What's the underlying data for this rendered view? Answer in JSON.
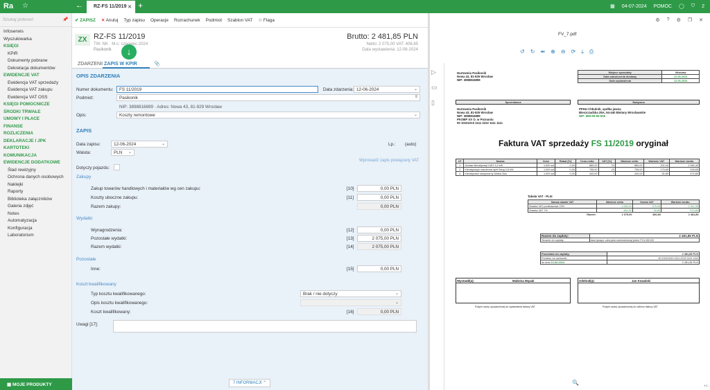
{
  "app": {
    "logo": "Ra",
    "tab_title": "RZ-FS 11/2019",
    "date": "04-07-2024",
    "help": "POMOC",
    "badge": "2"
  },
  "sidebar": {
    "search_placeholder": "Szukaj poleceń",
    "items": [
      {
        "label": "Infoserwis",
        "type": "item"
      },
      {
        "label": "Wyszukiwarka",
        "type": "item"
      },
      {
        "label": "KSIĘGI",
        "type": "head"
      },
      {
        "label": "KPiR",
        "type": "sub"
      },
      {
        "label": "Dokumenty pobrane",
        "type": "sub"
      },
      {
        "label": "Dekretacja dokumentów",
        "type": "sub"
      },
      {
        "label": "EWIDENCJE VAT",
        "type": "head"
      },
      {
        "label": "Ewidencja VAT sprzedaży",
        "type": "sub"
      },
      {
        "label": "Ewidencja VAT zakupu",
        "type": "sub"
      },
      {
        "label": "Ewidencja VAT OSS",
        "type": "sub"
      },
      {
        "label": "KSIĘGI POMOCNICZE",
        "type": "head"
      },
      {
        "label": "ŚRODKI TRWAŁE",
        "type": "head"
      },
      {
        "label": "UMOWY I PŁACE",
        "type": "head"
      },
      {
        "label": "FINANSE",
        "type": "head"
      },
      {
        "label": "ROZLICZENIA",
        "type": "head"
      },
      {
        "label": "DEKLARACJE I JPK",
        "type": "head"
      },
      {
        "label": "KARTOTEKI",
        "type": "head"
      },
      {
        "label": "KOMUNIKACJA",
        "type": "head"
      },
      {
        "label": "EWIDENCJE DODATKOWE",
        "type": "head"
      },
      {
        "label": "Ślad rewizyjny",
        "type": "sub"
      },
      {
        "label": "Ochrona danych osobowych",
        "type": "sub"
      },
      {
        "label": "Naklejki",
        "type": "sub"
      },
      {
        "label": "Raporty",
        "type": "sub"
      },
      {
        "label": "Biblioteka załączników",
        "type": "sub"
      },
      {
        "label": "Galeria zdjęć",
        "type": "sub"
      },
      {
        "label": "Notes",
        "type": "sub"
      },
      {
        "label": "Automatyzacja",
        "type": "sub"
      },
      {
        "label": "Konfiguracja",
        "type": "sub"
      },
      {
        "label": "Laboratorium",
        "type": "sub"
      }
    ],
    "my_products": "MOJE PRODUKTY"
  },
  "toolbar": {
    "save": "ZAPISZ",
    "cancel": "Anuluj",
    "type": "Typ zapisu",
    "ops": "Operacje",
    "settle": "Rozrachunek",
    "subject": "Podmiot",
    "template": "Szablon VAT",
    "flag": "Flaga"
  },
  "header": {
    "badge": "ZX",
    "title": "RZ-FS 11/2019",
    "sub": "TW: NK · M-c: czerwiec-2024",
    "sub2": "Pasikonik",
    "brutto": "Brutto: 2 481,85 PLN",
    "netto": "Netto: 2 075,00 VAT: 406,85",
    "issued": "Data wystawienia: 12-06-2024"
  },
  "tabs": {
    "event": "ZDARZENIE",
    "kpir": "ZAPIS W KPIR"
  },
  "event": {
    "section": "OPIS ZDARZENIA",
    "docnum_label": "Numer dokumentu:",
    "docnum": "FS 11/2019",
    "date_label": "Data zdarzenia:",
    "date": "12-06-2024",
    "subject_label": "Podmiot:",
    "subject": "Pasikonik",
    "nip": "NIP: 3898816899  ·  Adres: Nowa 43, 81-929 Wrocław",
    "desc_label": "Opis:",
    "desc": "Koszty remontowe"
  },
  "entry": {
    "section": "ZAPIS",
    "date_label": "Data zapisu:",
    "date": "12-06-2024",
    "lp_label": "Lp.:",
    "lp": "(auto)",
    "currency_label": "Waluta:",
    "currency": "PLN",
    "link": "Wprowadź zapis powiązany VAT",
    "vehicle": "Dotyczy pojazdu:"
  },
  "purchases": {
    "title": "Zakupy",
    "rows": [
      {
        "label": "Zakup towarów handlowych i materiałów wg cen zakupu:",
        "col": "[10]",
        "value": "0,00 PLN"
      },
      {
        "label": "Koszty uboczne zakupu:",
        "col": "[11]",
        "value": "0,00 PLN"
      },
      {
        "label": "Razem zakupy:",
        "col": "",
        "value": "0,00 PLN"
      }
    ]
  },
  "expenses": {
    "title": "Wydatki",
    "rows": [
      {
        "label": "Wynagrodzenia:",
        "col": "[12]",
        "value": "0,00 PLN"
      },
      {
        "label": "Pozostałe wydatki:",
        "col": "[13]",
        "value": "2 075,00 PLN"
      },
      {
        "label": "Razem wydatki:",
        "col": "[14]",
        "value": "2 075,00 PLN"
      }
    ]
  },
  "other": {
    "title": "Pozostałe",
    "label": "Inne:",
    "col": "[15]",
    "value": "0,00 PLN"
  },
  "qualified": {
    "title": "Koszt kwalifikowany",
    "type_label": "Typ kosztu kwalifikowanego:",
    "type": "Brak / nie dotyczy",
    "desc_label": "Opis kosztu kwalifikowanego:",
    "cost_label": "Koszt kwalifikowany:",
    "col": "[16]",
    "value": "0,00 PLN"
  },
  "notes_label": "Uwagi [17]:",
  "info_button": "7 INFORMACJI",
  "pdf": {
    "filename": "FV_7.pdf",
    "seller_top": [
      "Hurtownia Pasikonik",
      "Nowa 43, 81-929 Wrocław",
      "NIP: 3898816899"
    ],
    "place": {
      "label": "Miejsce sprzedaży",
      "value": "Wrocław"
    },
    "delivery": {
      "label": "Data zakończenia dostawy",
      "value": "12-06-2024"
    },
    "issue": {
      "label": "Data wystawienia",
      "value": "12-06-2024"
    },
    "seller_head": "Sprzedawca",
    "buyer_head": "Nabywca",
    "seller": [
      "Hurtownia Pasikonik",
      "Nowa 43, 81-929 Wrocław",
      "NIP: 3898816899",
      "PKOBP XX O. w Poznaniu",
      "00 10101010 1111 2222 1111 1111"
    ],
    "buyer": [
      "PPHU Chłodnik, spółka jawna",
      "Bieszczadzka 25A, 54-440 Bielany Wrocławskie",
      "NIP: 888-99-99-555"
    ],
    "title_pre": "Faktura VAT sprzedaży ",
    "title_num": "FS 11/2019",
    "title_post": " oryginał",
    "items_head": [
      "LP",
      "Nazwa",
      "Ilość",
      "Rabat [%]",
      "Cena netto",
      "VAT [%]",
      "Wartość netto",
      "Wartość VAT",
      "Wartość brutto"
    ],
    "items": [
      [
        "1",
        "Zestaw klimatyzacji LMG 3,2 kW",
        "1,000 szt",
        "0,00",
        "880,00",
        "23",
        "880,00",
        "202,40",
        "1 082,40"
      ],
      [
        "2",
        "Klimatyzacja naścienna split Sang 2,8 kW",
        "1,000 szt",
        "0,00",
        "755,00",
        "23",
        "755,00",
        "173,65",
        "928,65"
      ],
      [
        "3",
        "Klimatyzator stacjonarny Midea 2kw",
        "1,000 szt",
        "0,00",
        "440,00",
        "7",
        "440,00",
        "30,80",
        "470,80"
      ]
    ],
    "vat_title": "Tabela VAT - PLN:",
    "vat_head": [
      "Nazwa stawki VAT",
      "Wartość netto",
      "Kwota VAT",
      "Wartość brutto"
    ],
    "vat_rows": [
      [
        "Stawka VAT podstawowa 23%",
        "1 635,00",
        "375,05",
        "2 011,05"
      ],
      [
        "Stawka VAT 7%",
        "440,00",
        "30,80",
        "470,80"
      ]
    ],
    "vat_sum": [
      "Razem:",
      "2 075,00",
      "406,85",
      "2 481,85"
    ],
    "to_pay_label": "Razem do zapłaty:",
    "to_pay": "2 481,85 PLN",
    "in_words_label": "Słownie do zapłaty:",
    "in_words": "dwa tysiące czterysta osiemdziesiąt jeden PLN 85/100",
    "left_label": "Pozostało do zapłaty:",
    "left": "2 481,85 PLN",
    "transfer_label": "Przelew, na rachunek:",
    "transfer": "00 10101010 1111 2222 1111 1111",
    "due_label": "do dnia",
    "due": "13-06-2024",
    "due_amount": "2 481,85 PLN",
    "issued_label": "Wystawił(a):",
    "issued_by": "Malwina Wąsak",
    "recv_label": "Odebrał(a):",
    "recv_by": "Jan Kowalski",
    "sign_left": "Podpis osoby upoważnionej do wystawienia faktury VAT",
    "sign_right": "Podpis osoby upoważnionej do odbioru faktury VAT"
  }
}
